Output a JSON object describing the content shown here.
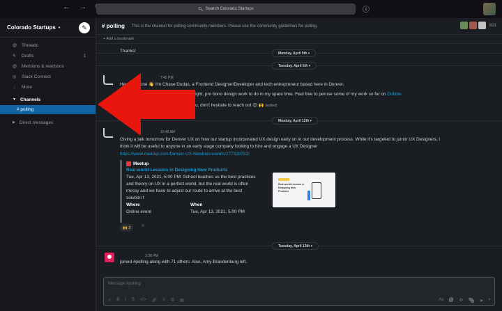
{
  "topbar": {
    "search_placeholder": "Search Colorado Startups",
    "back": "←",
    "forward": "→",
    "history": "⏲"
  },
  "sidebar": {
    "workspace": "Colorado Startups",
    "items": [
      {
        "label": "Threads",
        "icon": "@"
      },
      {
        "label": "Drafts",
        "icon": "✎",
        "count": "1"
      },
      {
        "label": "Mentions & reactions",
        "icon": "@"
      },
      {
        "label": "Slack Connect",
        "icon": "◎"
      },
      {
        "label": "More",
        "icon": "⋮"
      }
    ],
    "channels_label": "Channels",
    "active_channel": "# polling",
    "dm_label": "Direct messages"
  },
  "channel": {
    "name": "# polling",
    "topic": "This is the channel for polling community members. Please use the community guidelines for polling.",
    "member_count": "821",
    "bookmark": "+ Add a bookmark"
  },
  "dates": {
    "apr5": "Monday, April 5th",
    "apr6": "Tuesday, April 6th",
    "apr12": "Monday, April 12th",
    "apr13": "Tuesday, April 13th"
  },
  "messages": {
    "thanks": "Thanks!",
    "m1_time": "7:45 PM",
    "m1_l1a": "Hey everyone 👋 I'm Chase Dudas, a Frontend Designer/Developer and tech entrepreneur based here in Denver.",
    "m1_l2a": "me light, pro bono design work to do in my spare time. Feel free to peruse some of my work so far on",
    "m1_l2b": "Dribble",
    "m1_l3a": "o you, don't hesitate to reach out 😊 🙌",
    "m1_edited": "(edited)",
    "m2_time": "10:45 AM",
    "m2_l1": "Giving a talk tomorrow for Denver UX on how our startup incorporated UX design early on in our development process. While it's targeted to junior UX Designers, I",
    "m2_l2": "think it will be useful to anyone in an early stage company looking to hire and engage a UX Designer",
    "m2_link": "https://www.meetup.com/Denver-UX-Newbies/events/277328782/",
    "m3_time": "3:38 PM",
    "m3_text": "joined #polling along with 71 others. Also, Amy Brandenburg left."
  },
  "unfurl": {
    "site": "Meetup",
    "title": "Real-world Lessons in Designing New Products",
    "desc": "Tue, Apr 13, 2021, 5:00 PM: School teaches us the best practices and theory on UX in a perfect world, but the real world is often messy and we have to adjust our route to arrive at the best solution f",
    "where_label": "Where",
    "where_value": "Online event",
    "when_label": "When",
    "when_value": "Tue, Apr 13, 2021, 5:00 PM",
    "thumb_text": "Real-world Lessons in Designing New Products",
    "reaction": "🙌 2"
  },
  "composer": {
    "placeholder": "Message #polling"
  },
  "colors": {
    "active": "#1164a3",
    "arrow": "#e8160c",
    "link": "#1d9bd1"
  }
}
